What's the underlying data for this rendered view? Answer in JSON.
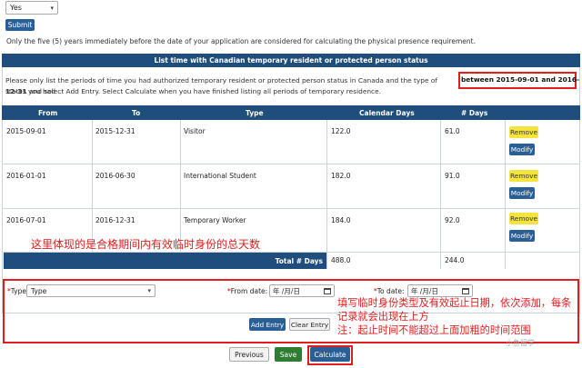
{
  "top": {
    "select_value": "Yes",
    "submit_label": "Submit",
    "note": "Only the five (5) years immediately before the date of your application are considered for calculating the physical presence requirement."
  },
  "panel": {
    "title": "List time with Canadian temporary resident or protected person status",
    "instruction_line1": "Please only list the periods of time you had authorized temporary resident or protected person status in Canada and the type of status you had",
    "highlight_1": "between 2015-09-01 and 2016-",
    "highlight_2": "12-31",
    "instruction_line2": "and select Add Entry. Select Calculate when you have finished listing all periods of temporary residence."
  },
  "table": {
    "headers": [
      "From",
      "To",
      "Type",
      "Calendar Days",
      "# Days"
    ],
    "rows": [
      {
        "from": "2015-09-01",
        "to": "2015-12-31",
        "type": "Visitor",
        "calendar_days": "122.0",
        "days": "61.0",
        "remove": "Remove",
        "modify": "Modify"
      },
      {
        "from": "2016-01-01",
        "to": "2016-06-30",
        "type": "International Student",
        "calendar_days": "182.0",
        "days": "91.0",
        "remove": "Remove",
        "modify": "Modify"
      },
      {
        "from": "2016-07-01",
        "to": "2016-12-31",
        "type": "Temporary Worker",
        "calendar_days": "184.0",
        "days": "92.0",
        "remove": "Remove",
        "modify": "Modify"
      }
    ],
    "total_label": "Total # Days",
    "total_calendar_days": "488.0",
    "total_days": "244.0"
  },
  "annotations": {
    "note1": "这里体现的是合格期间内有效临时身份的总天数",
    "note2": "填写临时身份类型及有效起止日期，依次添加，每条记录就会出现在上方\n注：起止时间不能超过上面加粗的时间范围"
  },
  "form": {
    "type_label": "Type",
    "type_value": "Type",
    "from_label": "From date:",
    "to_label": "To date:",
    "date_placeholder": "年 /月/日",
    "required_mark": "*",
    "add_entry": "Add Entry",
    "clear_entry": "Clear Entry"
  },
  "footer": {
    "previous": "Previous",
    "save": "Save",
    "calculate": "Calculate"
  },
  "watermark": "小鱼留学",
  "colors": {
    "header_blue": "#1f4e7d",
    "button_blue": "#2a5f96",
    "remove_yellow": "#f4e33c",
    "save_green": "#2e7d32",
    "annotation_red": "#e01e1e"
  }
}
